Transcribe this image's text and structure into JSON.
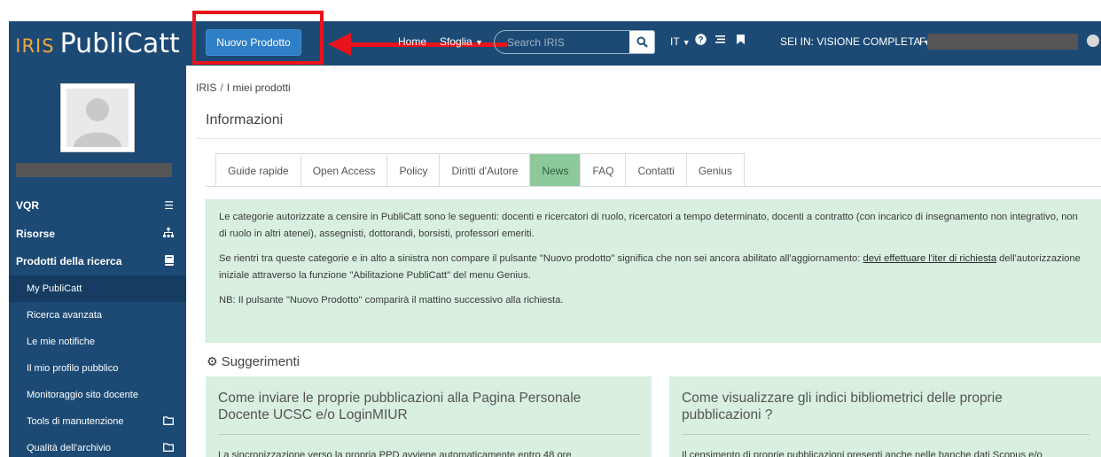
{
  "brand": {
    "iris": "IRIS",
    "name": "PubliCatt"
  },
  "navbar": {
    "new_product_label": "Nuovo Prodotto",
    "home_label": "Home",
    "browse_label": "Sfoglia",
    "search_placeholder": "Search IRIS",
    "language_label": "IT",
    "view_label": "SEI IN: VISIONE COMPLETA",
    "user_initial": "F",
    "colors": {
      "navbar_bg": "#1c4a74",
      "button_bg": "#2f7fc6",
      "annotation_red": "#e8141b"
    }
  },
  "sidebar": {
    "items": [
      {
        "label": "VQR",
        "icon": "list-icon"
      },
      {
        "label": "Risorse",
        "icon": "sitemap-icon"
      },
      {
        "label": "Prodotti della ricerca",
        "icon": "book-icon"
      }
    ],
    "subitems": [
      {
        "label": "My PubliCatt"
      },
      {
        "label": "Ricerca avanzata"
      },
      {
        "label": "Le mie notifiche"
      },
      {
        "label": "Il mio profilo pubblico"
      },
      {
        "label": "Monitoraggio sito docente"
      },
      {
        "label": "Tools di manutenzione",
        "icon": "folder-icon"
      },
      {
        "label": "Qualità dell'archivio",
        "icon": "folder-icon"
      }
    ]
  },
  "breadcrumb": {
    "root": "IRIS",
    "current": "I miei prodotti"
  },
  "panel": {
    "title": "Informazioni"
  },
  "tabs": [
    {
      "label": "Guide rapide"
    },
    {
      "label": "Open Access"
    },
    {
      "label": "Policy"
    },
    {
      "label": "Diritti d'Autore"
    },
    {
      "label": "News"
    },
    {
      "label": "FAQ"
    },
    {
      "label": "Contatti"
    },
    {
      "label": "Genius"
    }
  ],
  "news": {
    "p1": "Le categorie autorizzate a censire in PubliCatt sono le seguenti: docenti e ricercatori di ruolo, ricercatori a tempo determinato, docenti a contratto (con incarico di insegnamento non integrativo, non di ruolo in altri atenei), assegnisti, dottorandi, borsisti, professori emeriti.",
    "p2_before": "Se rientri tra queste categorie e in alto a sinistra non compare il pulsante \"Nuovo prodotto\" significa che non sei ancora abilitato all'aggiornamento: ",
    "p2_link": "devi effettuare l'iter di richiesta",
    "p2_after": " dell'autorizzazione iniziale attraverso la funzione \"Abilitazione PubliCatt\" del menu Genius.",
    "p3": "NB: Il pulsante \"Nuovo Prodotto\" comparirà il mattino successivo alla richiesta."
  },
  "suggestions": {
    "title": "Suggerimenti",
    "cards": [
      {
        "title": "Come inviare le proprie pubblicazioni alla Pagina Personale Docente UCSC e/o LoginMIUR",
        "body": "La sincronizzazione verso la propria PPD avviene automaticamente entro 48 ore"
      },
      {
        "title": "Come visualizzare gli indici bibliometrici delle proprie pubblicazioni ?",
        "body": "Il censimento di proprie pubblicazioni presenti anche nelle banche dati Scopus e/o"
      }
    ]
  }
}
